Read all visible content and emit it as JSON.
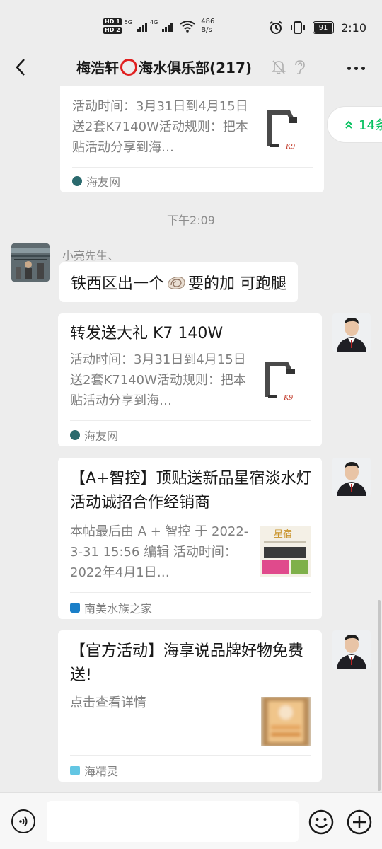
{
  "status_bar": {
    "hd1": "HD 1",
    "hd2": "HD 2",
    "net1": "5G",
    "net2": "4G",
    "speed_value": "486",
    "speed_unit": "B/s",
    "battery": "91",
    "time": "2:10"
  },
  "header": {
    "title_before_emoji": "梅浩轩",
    "title_after_emoji": "海水俱乐部(217)"
  },
  "unread_pill": {
    "label": "14条"
  },
  "messages": {
    "card0": {
      "desc": "活动时间：3月31日到4月15日送2套K7140W活动规则：把本贴活动分享到海…",
      "source": "海友网"
    },
    "timestamp": "下午2:09",
    "text_message": {
      "sender": "小亮先生、",
      "text_before_emoji": "铁西区出一个",
      "text_after_emoji": "要的加 可跑腿"
    },
    "card1": {
      "title": "转发送大礼 K7 140W",
      "desc": "活动时间：3月31日到4月15日送2套K7140W活动规则：把本贴活动分享到海…",
      "source": "海友网"
    },
    "card2": {
      "title": "【A+智控】顶贴送新品星宿淡水灯活动诚招合作经销商",
      "desc": "本帖最后由 A + 智控 于 2022-3-31 15:56 编辑 活动时间：2022年4月1日…",
      "source": "南美水族之家",
      "thumb_text": "星宿"
    },
    "card3": {
      "title": "【官方活动】海享说品牌好物免费送!",
      "desc": "点击查看详情",
      "source": "海精灵"
    }
  },
  "colors": {
    "background": "#ededed",
    "bubble": "#ffffff",
    "wechat_green": "#07c160",
    "ring_red": "#e02020",
    "muted_text": "#7f7f7f"
  },
  "icons": [
    "back-arrow-icon",
    "mute-bell-icon",
    "ear-icon",
    "more-icon",
    "voice-icon",
    "emoji-icon",
    "plus-icon",
    "double-chevron-up-icon"
  ]
}
